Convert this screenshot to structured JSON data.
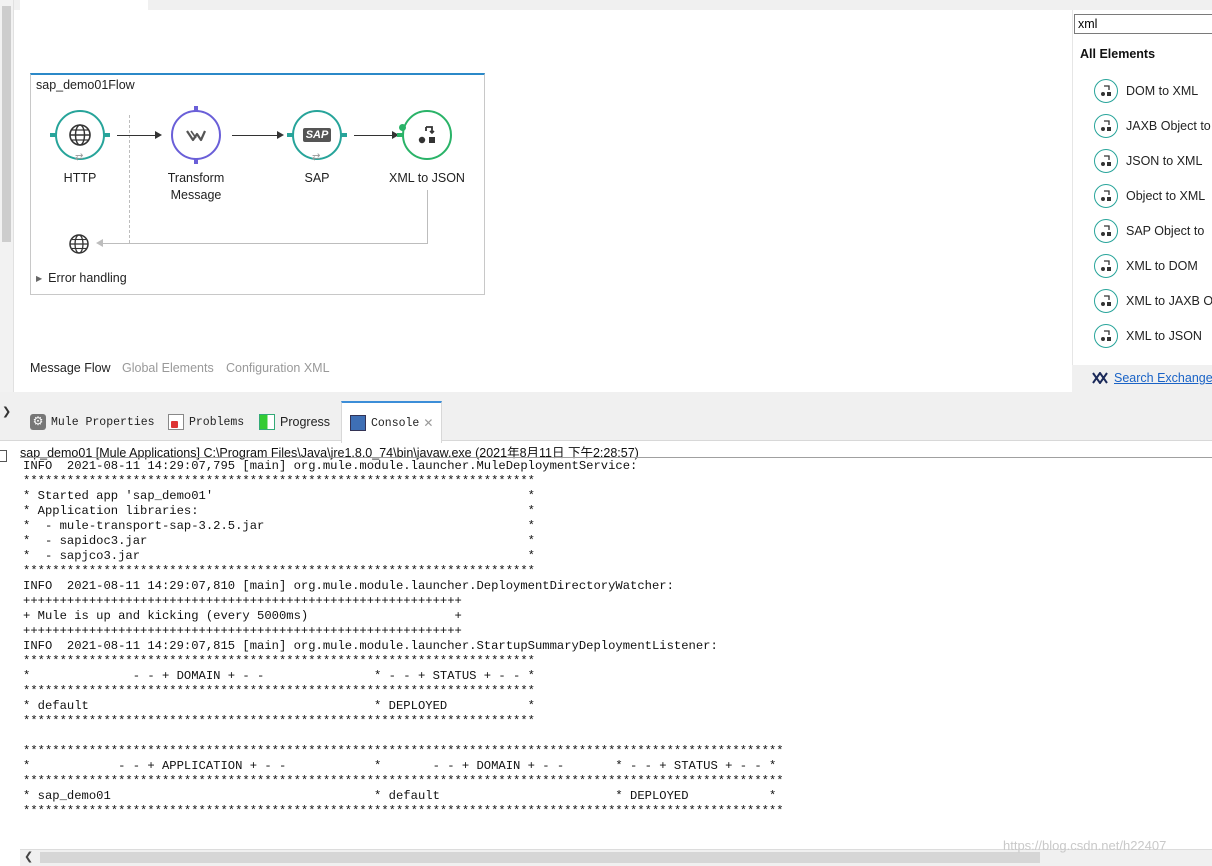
{
  "flow": {
    "title": "sap_demo01Flow",
    "nodes": [
      {
        "label_line1": "HTTP",
        "label_line2": ""
      },
      {
        "label_line1": "Transform",
        "label_line2": "Message"
      },
      {
        "label_line1": "SAP",
        "label_line2": ""
      },
      {
        "label_line1": "XML to JSON",
        "label_line2": ""
      }
    ],
    "sap_badge": "SAP",
    "error_handling": "Error handling"
  },
  "canvas_tabs": {
    "message_flow": "Message Flow",
    "global_elements": "Global Elements",
    "configuration_xml": "Configuration XML"
  },
  "palette": {
    "search_value": "xml",
    "heading": "All Elements",
    "items": [
      "DOM to XML",
      "JAXB Object to",
      "JSON to XML",
      "Object to XML",
      "SAP Object to",
      "XML to DOM",
      "XML to JAXB O",
      "XML to JSON"
    ],
    "exchange_link": "Search Exchange",
    "colors": {
      "accent": "#27a49a",
      "link": "#1a63c6"
    }
  },
  "view_tabs": {
    "mule_properties": "Mule Properties",
    "problems": "Problems",
    "progress": "Progress",
    "console": "Console"
  },
  "console": {
    "header": "sap_demo01 [Mule Applications] C:\\Program Files\\Java\\jre1.8.0_74\\bin\\javaw.exe (2021年8月11日 下午2:28:57)",
    "lines": [
      "INFO  2021-08-11 14:29:07,795 [main] org.mule.module.launcher.MuleDeploymentService:",
      "**********************************************************************",
      "* Started app 'sap_demo01'                                           *",
      "* Application libraries:                                             *",
      "*  - mule-transport-sap-3.2.5.jar                                    *",
      "*  - sapidoc3.jar                                                    *",
      "*  - sapjco3.jar                                                     *",
      "**********************************************************************",
      "INFO  2021-08-11 14:29:07,810 [main] org.mule.module.launcher.DeploymentDirectoryWatcher:",
      "++++++++++++++++++++++++++++++++++++++++++++++++++++++++++++",
      "+ Mule is up and kicking (every 5000ms)                    +",
      "++++++++++++++++++++++++++++++++++++++++++++++++++++++++++++",
      "INFO  2021-08-11 14:29:07,815 [main] org.mule.module.launcher.StartupSummaryDeploymentListener:",
      "**********************************************************************",
      "*              - - + DOMAIN + - -               * - - + STATUS + - - *",
      "**********************************************************************",
      "* default                                       * DEPLOYED           *",
      "**********************************************************************",
      "",
      "********************************************************************************************************",
      "*            - - + APPLICATION + - -            *       - - + DOMAIN + - -       * - - + STATUS + - - *",
      "********************************************************************************************************",
      "* sap_demo01                                    * default                        * DEPLOYED           *",
      "********************************************************************************************************"
    ]
  },
  "watermark": "https://blog.csdn.net/h22407"
}
